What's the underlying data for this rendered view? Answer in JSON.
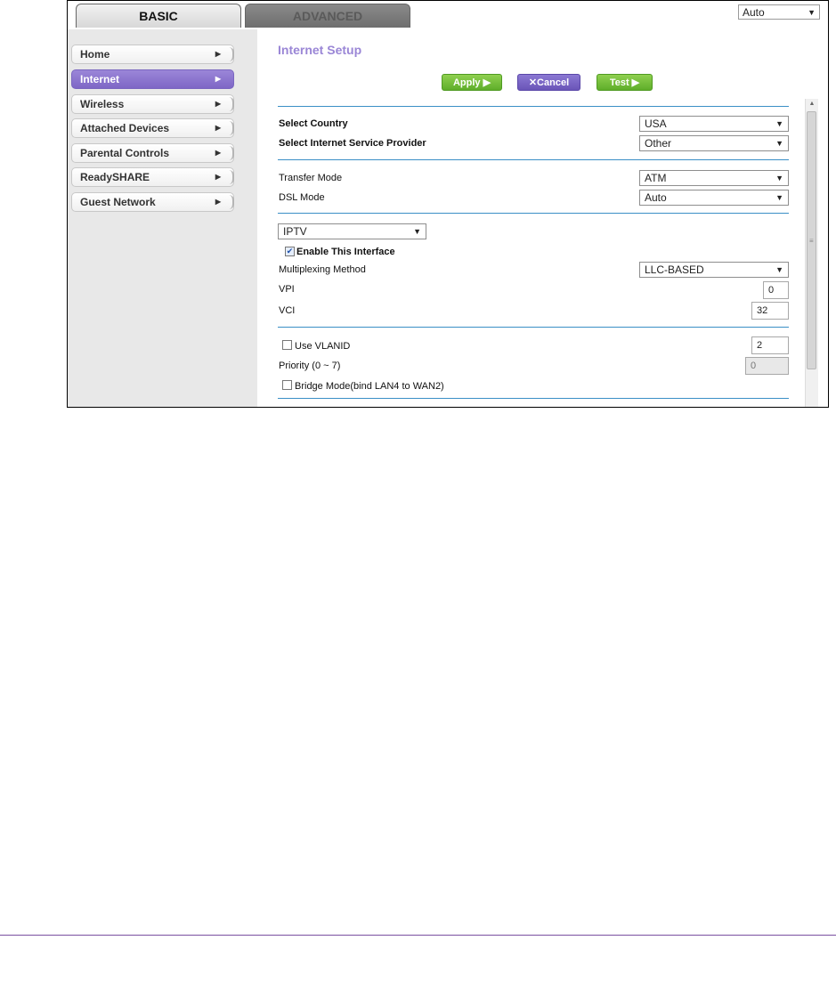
{
  "tabs": {
    "basic": "BASIC",
    "advanced": "ADVANCED"
  },
  "language": {
    "value": "Auto"
  },
  "sidebar": {
    "items": [
      {
        "label": "Home"
      },
      {
        "label": "Internet"
      },
      {
        "label": "Wireless"
      },
      {
        "label": "Attached Devices"
      },
      {
        "label": "Parental Controls"
      },
      {
        "label": "ReadySHARE"
      },
      {
        "label": "Guest Network"
      }
    ],
    "active_index": 1
  },
  "page": {
    "title": "Internet Setup"
  },
  "actions": {
    "apply": "Apply ▶",
    "cancel": "✕Cancel",
    "test": "Test ▶"
  },
  "form": {
    "country": {
      "label": "Select Country",
      "value": "USA"
    },
    "isp": {
      "label": "Select Internet Service Provider",
      "value": "Other"
    },
    "transfer_mode": {
      "label": "Transfer Mode",
      "value": "ATM"
    },
    "dsl_mode": {
      "label": "DSL Mode",
      "value": "Auto"
    },
    "interface": {
      "value": "IPTV"
    },
    "enable_interface": {
      "label": "Enable This Interface",
      "checked": true
    },
    "multiplexing": {
      "label": "Multiplexing Method",
      "value": "LLC-BASED"
    },
    "vpi": {
      "label": "VPI",
      "value": "0"
    },
    "vci": {
      "label": "VCI",
      "value": "32"
    },
    "vlanid": {
      "label": "Use VLANID",
      "checked": false,
      "value": "2"
    },
    "priority": {
      "label": "Priority  (0 ~ 7)",
      "value": "0"
    },
    "bridge_mode": {
      "label": "Bridge Mode(bind LAN4 to WAN2)",
      "checked": false
    }
  }
}
